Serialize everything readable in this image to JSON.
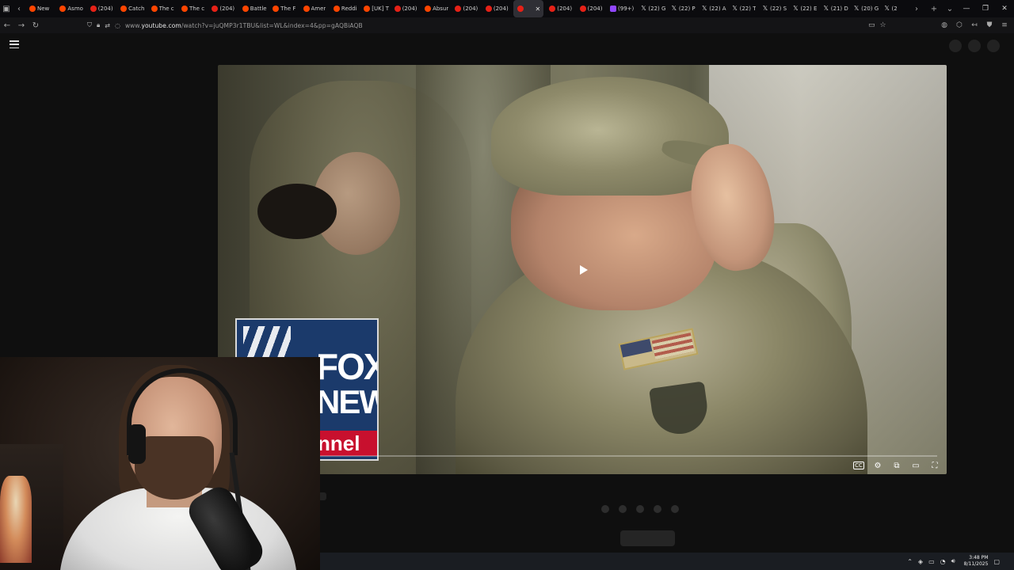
{
  "tabs": [
    {
      "title": "New",
      "icon": "reddit-icon"
    },
    {
      "title": "Asmo",
      "icon": "reddit-icon"
    },
    {
      "title": "(204)",
      "icon": "youtube-icon"
    },
    {
      "title": "Catch",
      "icon": "reddit-icon"
    },
    {
      "title": "The c",
      "icon": "reddit-icon"
    },
    {
      "title": "The c",
      "icon": "reddit-icon"
    },
    {
      "title": "(204)",
      "icon": "youtube-icon"
    },
    {
      "title": "Battle",
      "icon": "reddit-icon"
    },
    {
      "title": "The F",
      "icon": "reddit-icon"
    },
    {
      "title": "Amer",
      "icon": "reddit-icon"
    },
    {
      "title": "Reddi",
      "icon": "reddit-icon"
    },
    {
      "title": "[UK] T",
      "icon": "reddit-icon"
    },
    {
      "title": "(204)",
      "icon": "youtube-icon"
    },
    {
      "title": "Absur",
      "icon": "reddit-icon"
    },
    {
      "title": "(204)",
      "icon": "youtube-icon"
    },
    {
      "title": "(204)",
      "icon": "youtube-icon"
    },
    {
      "title": "",
      "icon": "youtube-icon",
      "active": true
    },
    {
      "title": "(204)",
      "icon": "youtube-icon"
    },
    {
      "title": "(204)",
      "icon": "youtube-icon"
    },
    {
      "title": "(99+)",
      "icon": "twitch-icon"
    },
    {
      "title": "(22) G",
      "icon": "x-icon"
    },
    {
      "title": "(22) P",
      "icon": "x-icon"
    },
    {
      "title": "(22) A",
      "icon": "x-icon"
    },
    {
      "title": "(22) T",
      "icon": "x-icon"
    },
    {
      "title": "(22) S",
      "icon": "x-icon"
    },
    {
      "title": "(22) E",
      "icon": "x-icon"
    },
    {
      "title": "(21) D",
      "icon": "x-icon"
    },
    {
      "title": "(20) G",
      "icon": "x-icon"
    },
    {
      "title": "(2",
      "icon": "x-icon"
    }
  ],
  "address_bar": {
    "url_prefix": "www.",
    "url_host": "youtube.com",
    "url_path": "/watch?v=juQMP3r1TBU&list=WL&index=4&pp=gAQBiAQB"
  },
  "video": {
    "overlay_logo_text": [
      "FOX",
      "NEWS",
      "nnel"
    ],
    "progress_fraction": 0.0,
    "controls": [
      "subtitles-icon",
      "settings-icon",
      "miniplayer-icon",
      "theater-icon",
      "fullscreen-icon"
    ]
  },
  "taskbar": {
    "time": "3:48 PM",
    "date": "8/11/2025"
  },
  "colors": {
    "youtube_red": "#e62117",
    "reddit_orange": "#ff4500",
    "twitch_purple": "#9146ff"
  }
}
